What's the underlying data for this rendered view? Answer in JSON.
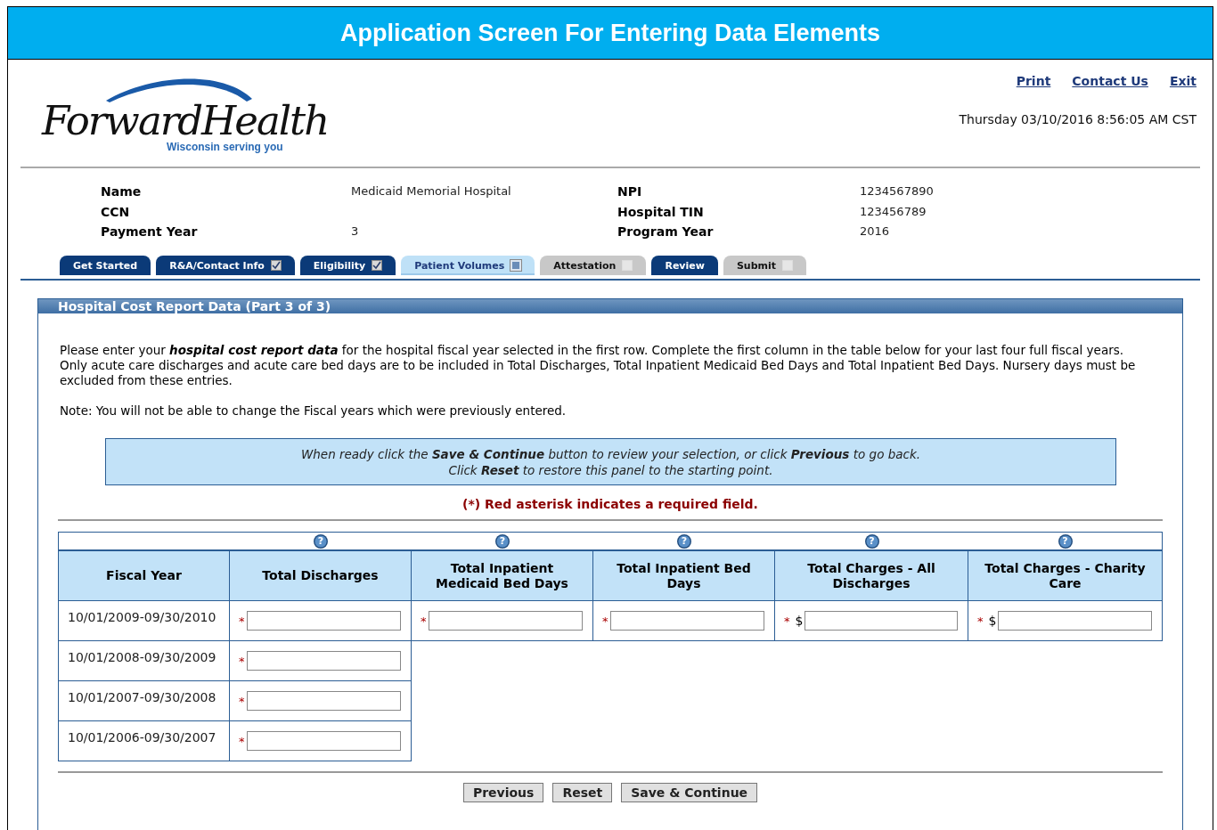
{
  "banner": {
    "title": "Application Screen For Entering Data Elements"
  },
  "logo": {
    "name": "ForwardHealth",
    "tagline": "Wisconsin serving you"
  },
  "top_links": [
    "Print",
    "Contact Us",
    "Exit"
  ],
  "timestamp": "Thursday 03/10/2016 8:56:05 AM CST",
  "info": [
    {
      "label": "Name",
      "value": "Medicaid Memorial Hospital"
    },
    {
      "label": "NPI",
      "value": "1234567890"
    },
    {
      "label": "CCN"
    },
    {
      "label": "Hospital TIN",
      "value": "123456789"
    },
    {
      "label": "Payment Year",
      "value": "3"
    },
    {
      "label": "Program Year",
      "value": "2016"
    }
  ],
  "tabs": [
    {
      "label": "Get Started",
      "selected": false,
      "kind": "done"
    },
    {
      "label": "R&A/Contact Info",
      "selected": false,
      "kind": "done",
      "checked": true
    },
    {
      "label": "Eligibility",
      "selected": false,
      "kind": "done",
      "checked": true
    },
    {
      "label": "Patient Volumes",
      "selected": true,
      "kind": "current",
      "checked": false
    },
    {
      "label": "Attestation",
      "selected": false,
      "kind": "locked",
      "checked": false
    },
    {
      "label": "Review",
      "selected": false,
      "kind": "done"
    },
    {
      "label": "Submit",
      "selected": false,
      "kind": "locked",
      "checked": false
    }
  ],
  "panel": {
    "title": "Hospital Cost Report Data (Part 3 of 3)",
    "intro": "Please enter your **hospital cost report data** for the hospital fiscal year selected in the first row. Complete the first column in the table below for your last four full fiscal years. Only acute care discharges and acute care bed days are to be included in Total Discharges, Total Inpatient Medicaid Bed Days and Total Inpatient Bed Days. Nursery days must be excluded from these entries.",
    "note": "Note: You will not be able to change the Fiscal years which were previously entered.",
    "instructions": [
      "When ready click the **Save & Continue** button to review your selection, or click **Previous** to go back.",
      "Click **Reset** to restore this panel to the starting point."
    ],
    "legend": "(*) Red asterisk indicates a required field.",
    "table": {
      "columns": [
        {
          "label": "Fiscal Year"
        },
        {
          "label": "Total Discharges",
          "help": "?"
        },
        {
          "label": "Total Inpatient Medicaid Bed Days",
          "help": "?"
        },
        {
          "label": "Total Inpatient Bed Days",
          "help": "?"
        },
        {
          "label": "Total Charges - All Discharges",
          "help": "?"
        },
        {
          "label": "Total Charges - Charity Care",
          "help": "?"
        }
      ],
      "rows": [
        {
          "fiscal_year": "10/01/2009-09/30/2010",
          "fields": [
            {
              "mark": "*"
            },
            {
              "mark": "*"
            },
            {
              "mark": "*"
            },
            {
              "mark": "*",
              "prefix": "$"
            },
            {
              "mark": "*",
              "prefix": "$"
            }
          ]
        },
        {
          "fiscal_year": "10/01/2008-09/30/2009",
          "fields": [
            {
              "mark": "*"
            }
          ]
        },
        {
          "fiscal_year": "10/01/2007-09/30/2008",
          "fields": [
            {
              "mark": "*"
            }
          ]
        },
        {
          "fiscal_year": "10/01/2006-09/30/2007",
          "fields": [
            {
              "mark": "*"
            }
          ]
        }
      ]
    },
    "buttons": [
      "Previous",
      "Reset",
      "Save & Continue"
    ]
  }
}
